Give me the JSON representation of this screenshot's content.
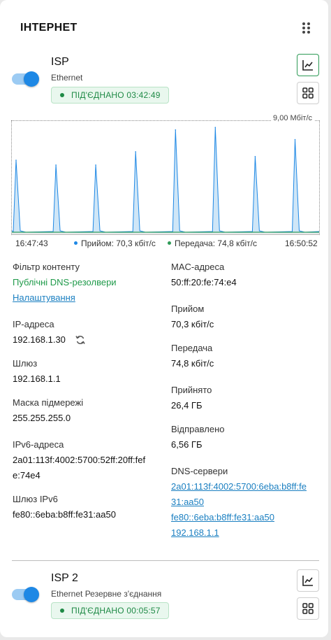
{
  "widget": {
    "title": "ІНТЕРНЕТ"
  },
  "isp1": {
    "name": "ISP",
    "type": "Ethernet",
    "status": "ПІД'ЄДНАНО 03:42:49",
    "enabled": true
  },
  "chart": {
    "ymax_label": "9,00 Мбіт/с",
    "start_time": "16:47:43",
    "end_time": "16:50:52",
    "legend_rx": "Прийом: 70,3 кбіт/с",
    "legend_tx": "Передача: 74,8 кбіт/с",
    "colors": {
      "rx": "#1e88e5",
      "rx_fill": "#cfe6f7",
      "tx": "#2e9a56"
    }
  },
  "chart_data": {
    "type": "area",
    "ylim": [
      0,
      9.0
    ],
    "y_unit": "Мбіт/с",
    "x_range": [
      "16:47:43",
      "16:50:52"
    ],
    "series": [
      {
        "name": "Прийом",
        "peaks_mbps": [
          6.0,
          5.6,
          5.6,
          6.7,
          8.5,
          8.7,
          6.3,
          7.7
        ]
      },
      {
        "name": "Передача",
        "peaks_mbps": [
          0.1,
          0.1,
          0.1,
          0.1,
          0.1,
          0.1,
          0.1,
          0.1
        ]
      }
    ]
  },
  "details": {
    "filter_label": "Фільтр контенту",
    "filter_value": "Публічні DNS-резолвери",
    "filter_link": "Налаштування",
    "ip_label": "IP-адреса",
    "ip_value": "192.168.1.30",
    "gateway_label": "Шлюз",
    "gateway_value": "192.168.1.1",
    "mask_label": "Маска підмережі",
    "mask_value": "255.255.255.0",
    "ipv6_label": "IPv6-адреса",
    "ipv6_value_1": "2a01:113f:4002:5700:52ff:20ff:fef",
    "ipv6_value_2": "e:74e4",
    "ipv6_gw_label": "Шлюз IPv6",
    "ipv6_gw_value": "fe80::6eba:b8ff:fe31:aa50",
    "mac_label": "MAC-адреса",
    "mac_value": "50:ff:20:fe:74:e4",
    "rx_label": "Прийом",
    "rx_value": "70,3 кбіт/с",
    "tx_label": "Передача",
    "tx_value": "74,8 кбіт/с",
    "received_label": "Прийнято",
    "received_value": "26,4 ГБ",
    "sent_label": "Відправлено",
    "sent_value": "6,56 ГБ",
    "dns_label": "DNS-сервери",
    "dns_1a": "2a01:113f:4002:5700:6eba:b8ff:fe",
    "dns_1b": "31:aa50",
    "dns_2": "fe80::6eba:b8ff:fe31:aa50",
    "dns_3": "192.168.1.1"
  },
  "isp2": {
    "name": "ISP 2",
    "type": "Ethernet Резервне з'єднання",
    "status": "ПІД'ЄДНАНО 00:05:57",
    "enabled": true
  },
  "icons": {
    "drag": "drag-handle-icon",
    "chart": "line-chart-icon",
    "grid": "grid-icon",
    "refresh": "refresh-icon"
  }
}
